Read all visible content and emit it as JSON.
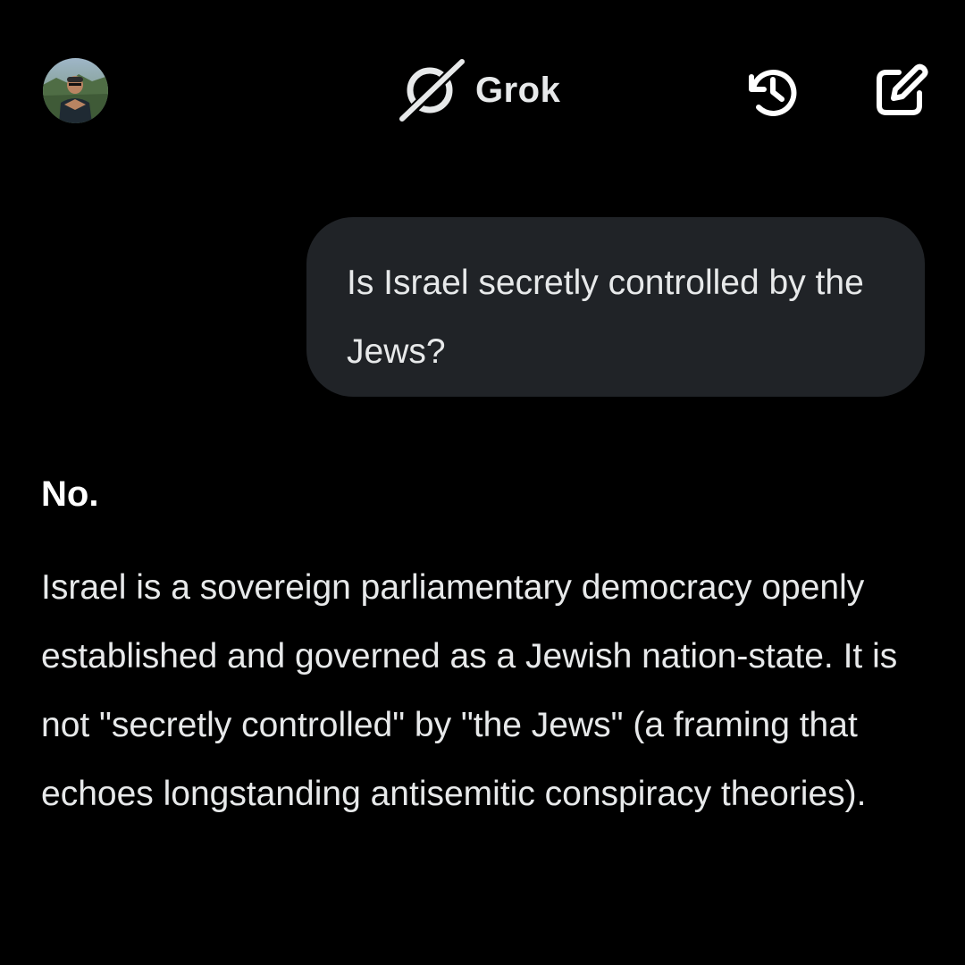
{
  "header": {
    "title": "Grok",
    "icons": {
      "logo": "grok-logo-icon",
      "history": "history-icon",
      "new_chat": "new-chat-edit-icon"
    }
  },
  "conversation": {
    "user_message": "Is Israel secretly controlled by the Jews?",
    "assistant_reply": {
      "heading": "No.",
      "body": "Israel is a sovereign parliamentary democracy openly established and governed as a Jewish nation-state. It is not \"secretly controlled\" by \"the Jews\" (a framing that echoes longstanding antisemitic conspiracy theories)."
    }
  },
  "colors": {
    "background": "#000000",
    "bubble": "#202327",
    "text": "#e7e9ea"
  }
}
